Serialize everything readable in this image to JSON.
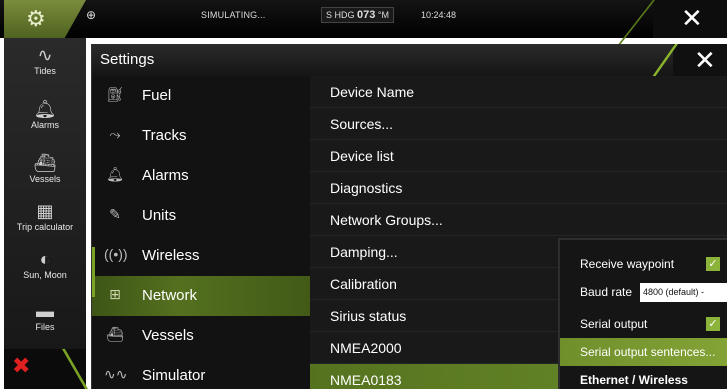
{
  "statusbar": {
    "simulating": "SIMULATING...",
    "hdg_prefix": "S HDG",
    "hdg_value": "073",
    "hdg_unit": "°M",
    "time": "10:24:48"
  },
  "sidebar": {
    "items": [
      {
        "label": "Tides",
        "icon": "tides-icon"
      },
      {
        "label": "Alarms",
        "icon": "bell-icon"
      },
      {
        "label": "Vessels",
        "icon": "vessels-icon"
      },
      {
        "label": "Trip calculator",
        "icon": "trip-calculator-icon"
      },
      {
        "label": "Sun, Moon",
        "icon": "sun-moon-icon"
      },
      {
        "label": "Files",
        "icon": "folder-icon"
      }
    ]
  },
  "dialog": {
    "title": "Settings",
    "categories": [
      {
        "label": "Fuel",
        "icon": "fuel-icon"
      },
      {
        "label": "Tracks",
        "icon": "tracks-icon"
      },
      {
        "label": "Alarms",
        "icon": "bell-icon"
      },
      {
        "label": "Units",
        "icon": "pencil-icon"
      },
      {
        "label": "Wireless",
        "icon": "wireless-icon"
      },
      {
        "label": "Network",
        "icon": "network-icon",
        "selected": true
      },
      {
        "label": "Vessels",
        "icon": "vessels-icon"
      },
      {
        "label": "Simulator",
        "icon": "simulator-icon"
      }
    ],
    "options": [
      {
        "label": "Device Name"
      },
      {
        "label": "Sources..."
      },
      {
        "label": "Device list"
      },
      {
        "label": "Diagnostics"
      },
      {
        "label": "Network Groups..."
      },
      {
        "label": "Damping..."
      },
      {
        "label": "Calibration"
      },
      {
        "label": "Sirius status"
      },
      {
        "label": "NMEA2000"
      },
      {
        "label": "NMEA0183",
        "selected": true
      }
    ]
  },
  "popup": {
    "receive_waypoint": "Receive waypoint",
    "baud_rate": "Baud rate",
    "baud_value": "4800 (default) -",
    "serial_output": "Serial output",
    "serial_output_sentences": "Serial output sentences...",
    "ethernet_wireless": "Ethernet / Wireless"
  },
  "colors": {
    "accent": "#6a8b2a",
    "close_x": "#ffffff",
    "error_x": "#e02020"
  }
}
